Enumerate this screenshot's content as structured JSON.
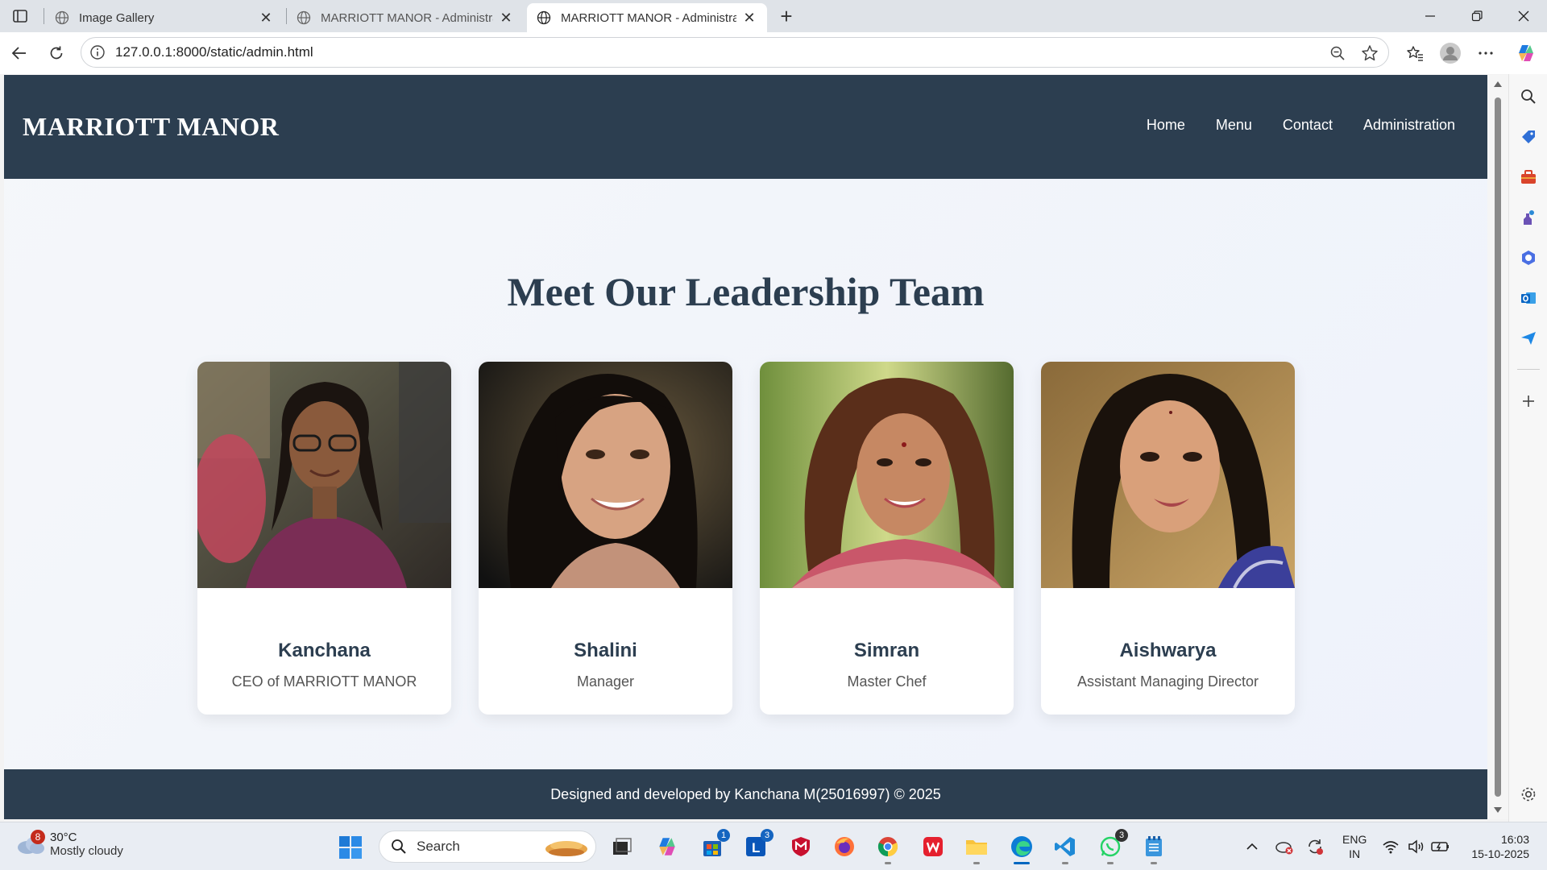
{
  "browser": {
    "tabs": [
      {
        "title": "Image Gallery",
        "active": false
      },
      {
        "title": "MARRIOTT MANOR - Administration",
        "active": false
      },
      {
        "title": "MARRIOTT MANOR - Administration",
        "active": true
      }
    ],
    "url": "127.0.0.1:8000/static/admin.html"
  },
  "site": {
    "brand": "MARRIOTT MANOR",
    "nav": [
      "Home",
      "Menu",
      "Contact",
      "Administration"
    ],
    "section_title": "Meet Our Leadership Team",
    "team": [
      {
        "name": "Kanchana",
        "role": "CEO of MARRIOTT MANOR"
      },
      {
        "name": "Shalini",
        "role": "Manager"
      },
      {
        "name": "Simran",
        "role": "Master Chef"
      },
      {
        "name": "Aishwarya",
        "role": "Assistant Managing Director"
      }
    ],
    "footer": "Designed and developed by Kanchana M(25016997) © 2025"
  },
  "taskbar": {
    "weather_temp": "30°C",
    "weather_cond": "Mostly cloudy",
    "weather_badge": "8",
    "search_label": "Search",
    "badges": {
      "store": "1",
      "lens": "3",
      "whatsapp": "3"
    },
    "lang_top": "ENG",
    "lang_bottom": "IN",
    "time": "16:03",
    "date": "15-10-2025"
  },
  "colors": {
    "header_bg": "#2c3e50",
    "accent": "#0067c0"
  }
}
